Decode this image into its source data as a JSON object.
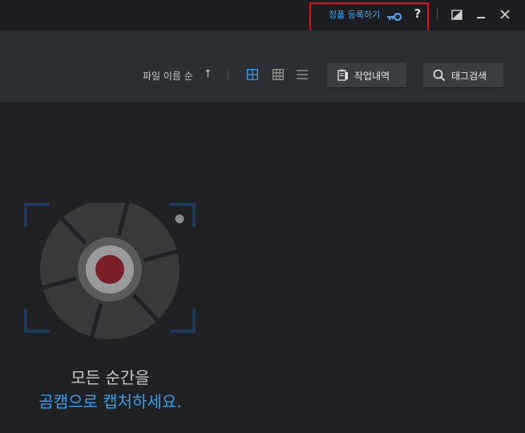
{
  "titlebar": {
    "register_label": "정품 등록하기",
    "register_icon": "key-icon",
    "help_label": "?",
    "accent_color": "#4aa3e8",
    "highlight_color": "#e01010",
    "buttons": [
      "restore-icon",
      "minimize-icon",
      "close-icon"
    ]
  },
  "toolbar": {
    "sort_label": "파일 이름 순",
    "sort_arrow": "↑",
    "view_modes": [
      "large-grid-icon",
      "small-grid-icon",
      "list-icon"
    ],
    "active_view": "large-grid-icon",
    "history_button": "작업내역",
    "tag_search_button": "태그검색"
  },
  "empty_state": {
    "line1": "모든 순간을",
    "line2": "곰캠으로 캡처하세요.",
    "graphic": "camera-shutter-icon"
  }
}
